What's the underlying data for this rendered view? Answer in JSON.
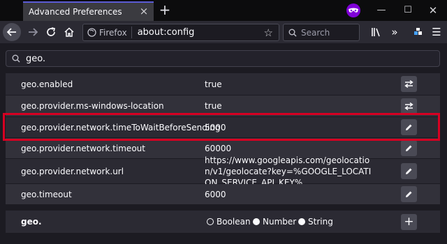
{
  "tab": {
    "title": "Advanced Preferences"
  },
  "navbar": {
    "identity_label": "Firefox",
    "url": "about:config",
    "search_placeholder": "Search"
  },
  "filter": {
    "value": "geo."
  },
  "prefs": [
    {
      "name": "geo.enabled",
      "value": "true",
      "action": "toggle-icon"
    },
    {
      "name": "geo.provider.ms-windows-location",
      "value": "true",
      "action": "toggle-icon"
    },
    {
      "name": "geo.provider.network.timeToWaitBeforeSending",
      "value": "5000",
      "action": "edit-icon"
    },
    {
      "name": "geo.provider.network.timeout",
      "value": "60000",
      "action": "edit-icon"
    },
    {
      "name": "geo.provider.network.url",
      "value": "https://www.googleapis.com/geolocation/v1/geolocate?key=%GOOGLE_LOCATION_SERVICE_API_KEY%",
      "action": "edit-icon"
    },
    {
      "name": "geo.timeout",
      "value": "6000",
      "action": "edit-icon"
    }
  ],
  "add_row": {
    "name": "geo.",
    "types": [
      "Boolean",
      "Number",
      "String"
    ],
    "selected_type": "Boolean"
  },
  "colors": {
    "highlight": "#d70022",
    "private_badge": "#8000d7"
  }
}
